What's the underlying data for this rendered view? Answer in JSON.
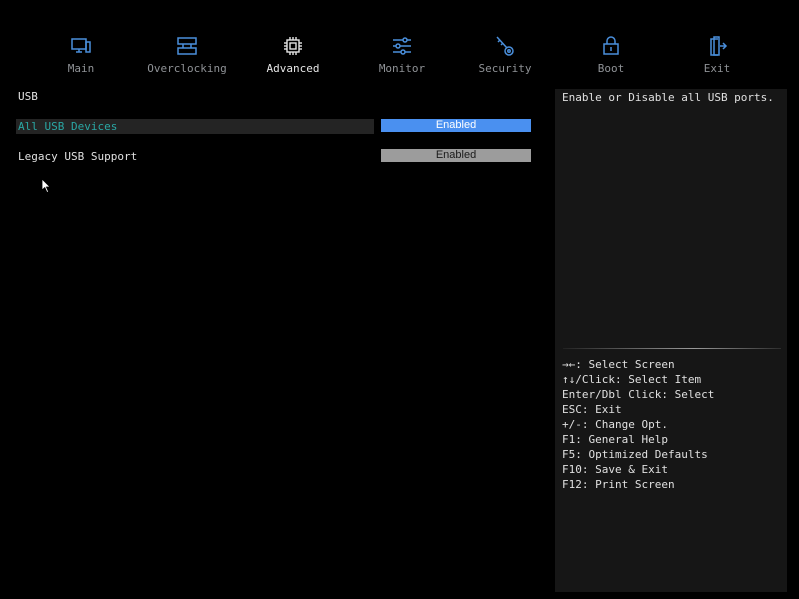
{
  "colors": {
    "background": "#000000",
    "icon": "#4a8fdc",
    "selected_value_bg": "#4a90f0",
    "unselected_value_bg": "#9c9c9c",
    "selected_label": "#2aa7a4",
    "help_panel_bg": "#161616"
  },
  "nav": {
    "tabs": [
      {
        "label": "Main",
        "icon": "monitor-icon",
        "active": false
      },
      {
        "label": "Overclocking",
        "icon": "sliders-rack-icon",
        "active": false
      },
      {
        "label": "Advanced",
        "icon": "chip-icon",
        "active": true
      },
      {
        "label": "Monitor",
        "icon": "adjust-sliders-icon",
        "active": false
      },
      {
        "label": "Security",
        "icon": "key-icon",
        "active": false
      },
      {
        "label": "Boot",
        "icon": "lock-icon",
        "active": false
      },
      {
        "label": "Exit",
        "icon": "exit-door-icon",
        "active": false
      }
    ]
  },
  "main": {
    "section_title": "USB",
    "rows": [
      {
        "label": "All USB Devices",
        "value": "Enabled",
        "selected": true
      },
      {
        "label": "Legacy USB Support",
        "value": "Enabled",
        "selected": false
      }
    ]
  },
  "help": {
    "description": "Enable or Disable all USB ports.",
    "keys": [
      "→←: Select Screen",
      "↑↓/Click: Select Item",
      "Enter/Dbl Click: Select",
      "ESC: Exit",
      "+/-: Change Opt.",
      "F1: General Help",
      "F5: Optimized Defaults",
      "F10: Save & Exit",
      "F12: Print Screen"
    ]
  }
}
